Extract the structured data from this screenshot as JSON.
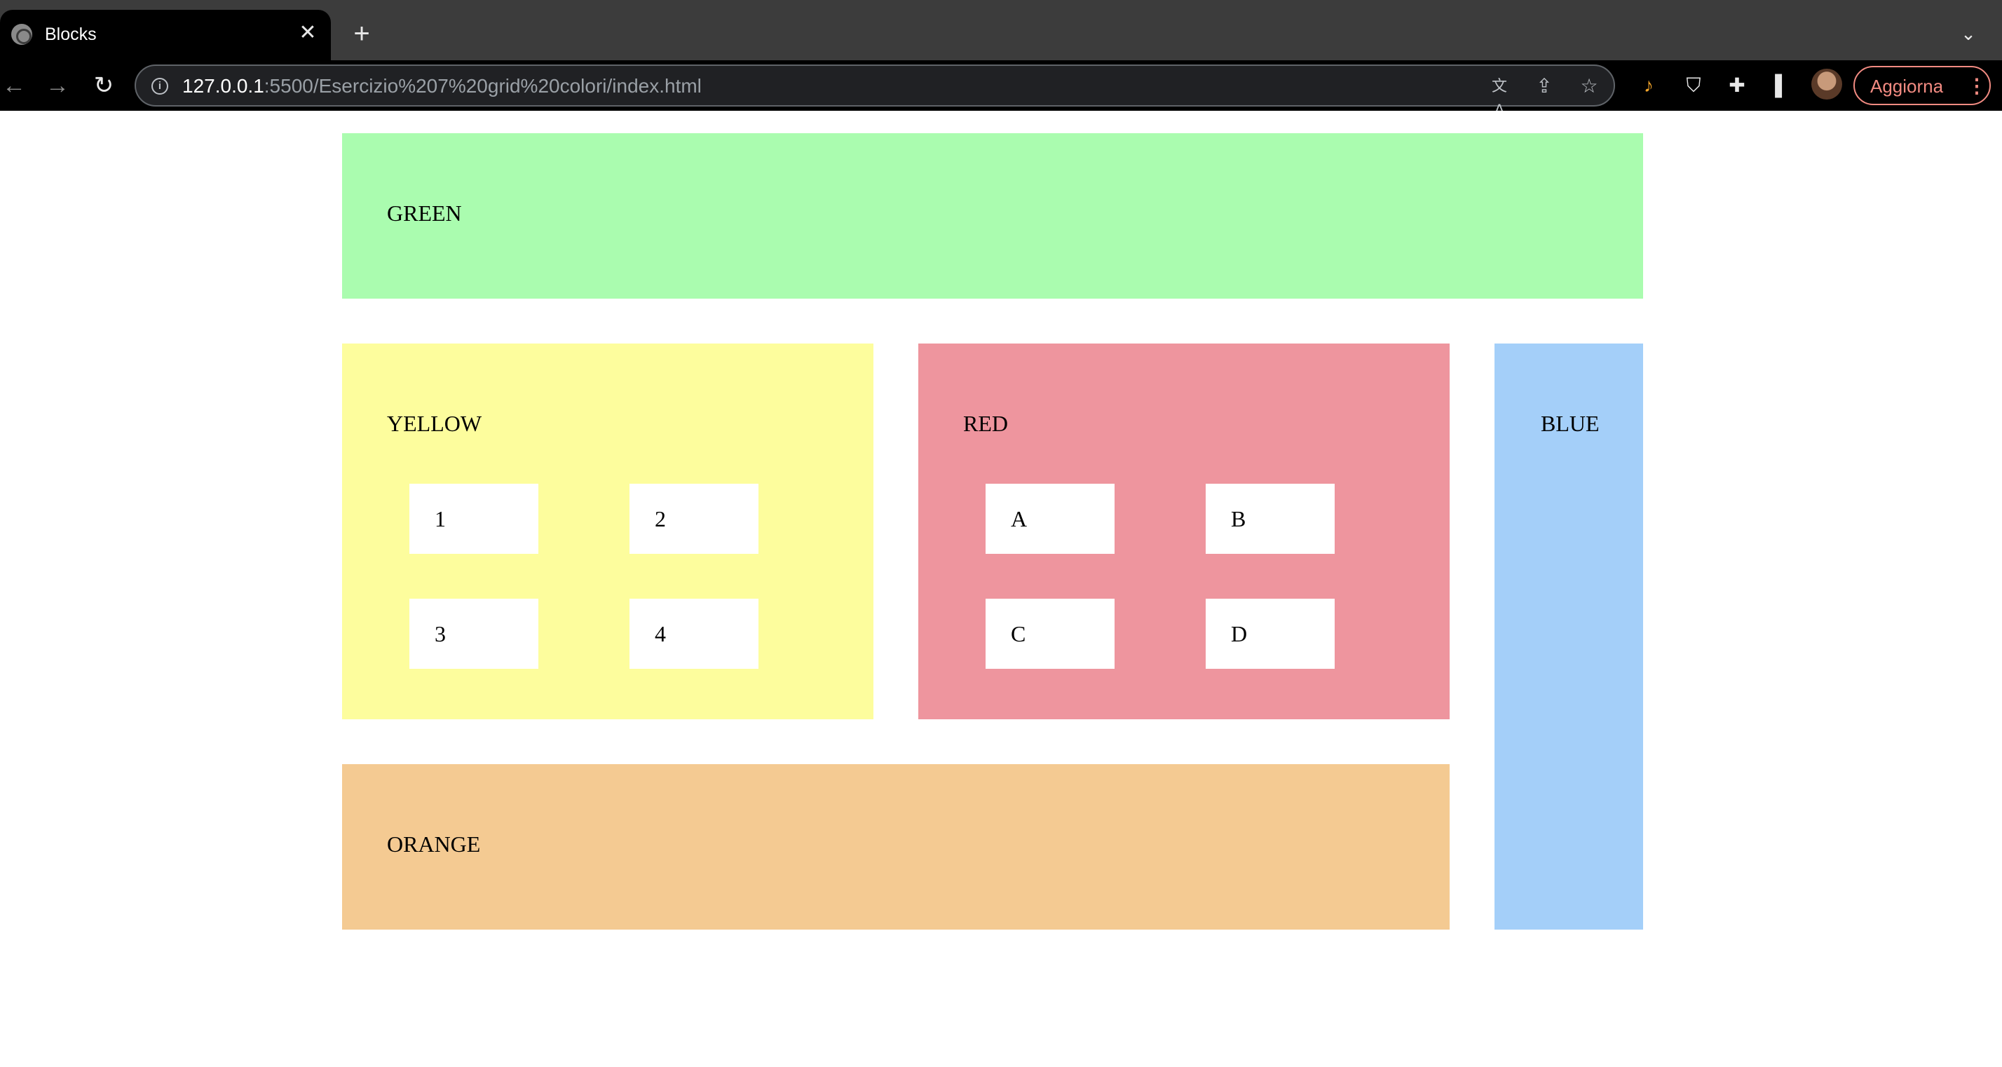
{
  "browser": {
    "tab": {
      "title": "Blocks",
      "favicon": "globe-icon",
      "close_glyph": "✕"
    },
    "new_tab_glyph": "+",
    "tab_list_glyph": "⌄",
    "nav": {
      "back": "←",
      "forward": "→",
      "reload": "↻"
    },
    "address": {
      "host": "127.0.0.1",
      "rest": ":5500/Esercizio%207%20grid%20colori/index.html"
    },
    "icons": {
      "translate": "文A",
      "share": "⇪",
      "star": "☆",
      "info": "i",
      "extension": "♪",
      "shield": "⛉",
      "puzzle": "✚",
      "side_panel": "▌"
    },
    "update_button": {
      "label": "Aggiorna",
      "menu": "⋮"
    }
  },
  "page": {
    "blocks": {
      "green": {
        "label": "GREEN",
        "color": "#aafcaf"
      },
      "yellow": {
        "label": "YELLOW",
        "color": "#fdfd9d",
        "items": [
          "1",
          "2",
          "3",
          "4"
        ]
      },
      "red": {
        "label": "RED",
        "color": "#ee959e",
        "items": [
          "A",
          "B",
          "C",
          "D"
        ]
      },
      "blue": {
        "label": "BLUE",
        "color": "#a4cff9"
      },
      "orange": {
        "label": "ORANGE",
        "color": "#f4ca92"
      }
    }
  }
}
